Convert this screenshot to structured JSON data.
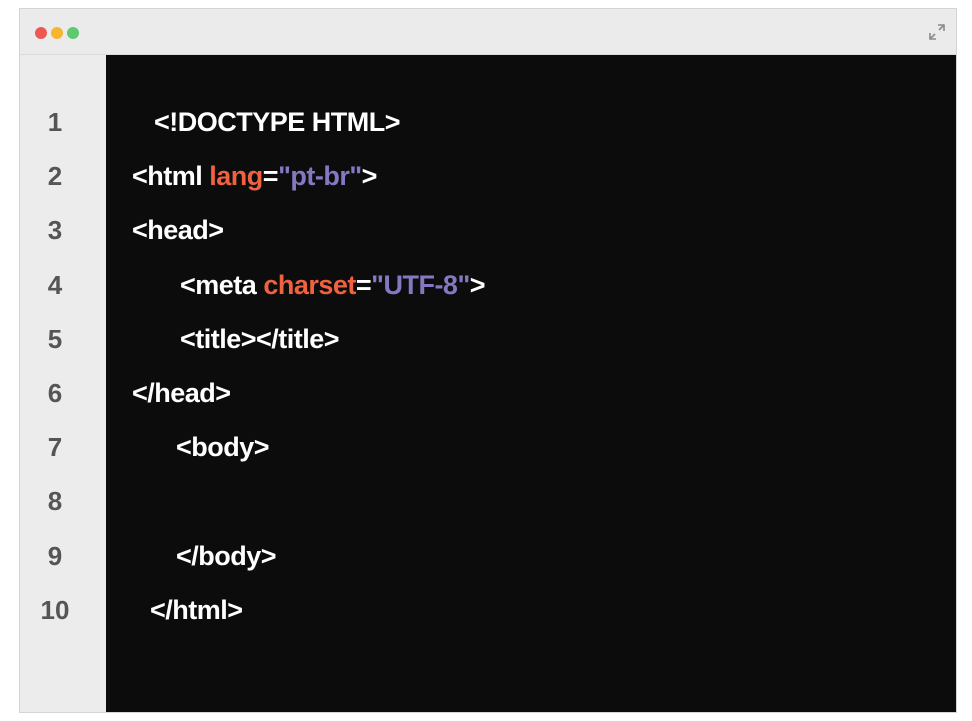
{
  "window": {
    "traffic_lights": [
      {
        "name": "close",
        "color": "#ee5852"
      },
      {
        "name": "minimize",
        "color": "#f6b630"
      },
      {
        "name": "maximize",
        "color": "#5ec96f"
      }
    ],
    "expand_icon": "expand-arrows-icon"
  },
  "colors": {
    "tag": "#ffffff",
    "attribute": "#f0623f",
    "value": "#8677c2",
    "line_number": "#555555",
    "editor_background": "#0d0c0d",
    "gutter_background": "#ececec"
  },
  "lines": [
    {
      "number": "1",
      "tokens": [
        {
          "text": "<!DOCTYPE HTML>",
          "kind": "tag"
        }
      ]
    },
    {
      "number": "2",
      "tokens": [
        {
          "text": "<html ",
          "kind": "tag"
        },
        {
          "text": "lang",
          "kind": "attribute"
        },
        {
          "text": "=",
          "kind": "tag"
        },
        {
          "text": "\"pt-br\"",
          "kind": "value"
        },
        {
          "text": ">",
          "kind": "tag"
        }
      ]
    },
    {
      "number": "3",
      "tokens": [
        {
          "text": "<head>",
          "kind": "tag"
        }
      ]
    },
    {
      "number": "4",
      "tokens": [
        {
          "text": "<meta ",
          "kind": "tag"
        },
        {
          "text": "charset",
          "kind": "attribute"
        },
        {
          "text": "=",
          "kind": "tag"
        },
        {
          "text": "\"UTF-8\"",
          "kind": "value"
        },
        {
          "text": ">",
          "kind": "tag"
        }
      ]
    },
    {
      "number": "5",
      "tokens": [
        {
          "text": "<title></title>",
          "kind": "tag"
        }
      ]
    },
    {
      "number": "6",
      "tokens": [
        {
          "text": "</head>",
          "kind": "tag"
        }
      ]
    },
    {
      "number": "7",
      "tokens": [
        {
          "text": "<body>",
          "kind": "tag"
        }
      ]
    },
    {
      "number": "8",
      "tokens": []
    },
    {
      "number": "9",
      "tokens": [
        {
          "text": "</body>",
          "kind": "tag"
        }
      ]
    },
    {
      "number": "10",
      "tokens": [
        {
          "text": "</html>",
          "kind": "tag"
        }
      ]
    }
  ]
}
